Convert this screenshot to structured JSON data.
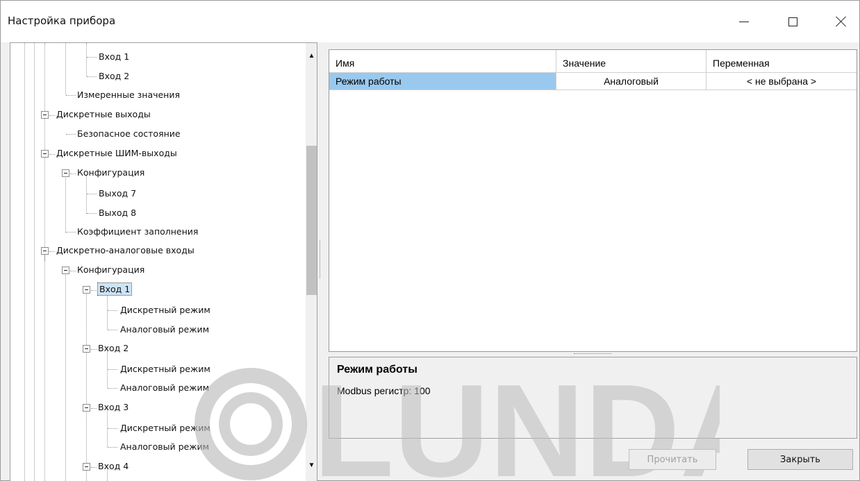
{
  "window": {
    "title": "Настройка прибора"
  },
  "titlebar_icons": [
    "minimize-icon",
    "maximize-icon",
    "close-icon"
  ],
  "tree": {
    "items": [
      {
        "label": "Вход 1"
      },
      {
        "label": "Вход 2"
      },
      {
        "label": "Измеренные значения"
      },
      {
        "label": "Дискретные выходы"
      },
      {
        "label": "Безопасное состояние"
      },
      {
        "label": "Дискретные ШИМ-выходы"
      },
      {
        "label": "Конфигурация"
      },
      {
        "label": "Выход 7"
      },
      {
        "label": "Выход 8"
      },
      {
        "label": "Коэффициент заполнения"
      },
      {
        "label": "Дискретно-аналоговые входы"
      },
      {
        "label": "Конфигурация"
      },
      {
        "label": "Вход 1"
      },
      {
        "label": "Дискретный режим"
      },
      {
        "label": "Аналоговый режим"
      },
      {
        "label": "Вход 2"
      },
      {
        "label": "Дискретный режим"
      },
      {
        "label": "Аналоговый режим"
      },
      {
        "label": "Вход 3"
      },
      {
        "label": "Дискретный режим"
      },
      {
        "label": "Аналоговый режим"
      },
      {
        "label": "Вход 4"
      }
    ]
  },
  "grid": {
    "columns": [
      "Имя",
      "Значение",
      "Переменная"
    ],
    "rows": [
      {
        "name": "Режим работы",
        "value": "Аналоговый",
        "variable": "< не выбрана >"
      }
    ]
  },
  "description": {
    "title": "Режим работы",
    "text": "Modbus регистр: 100"
  },
  "buttons": {
    "read": "Прочитать",
    "close": "Закрыть"
  },
  "watermark": {
    "text": "LUNDA"
  }
}
